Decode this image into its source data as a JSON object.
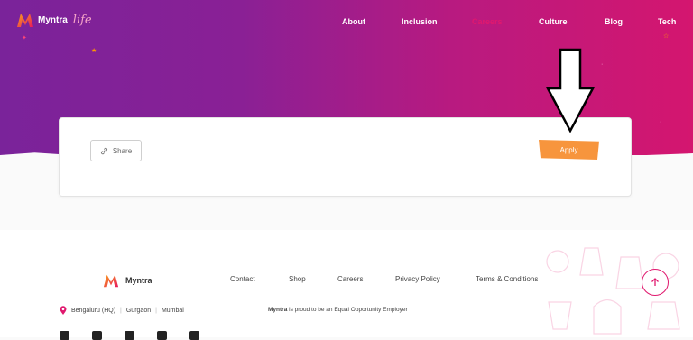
{
  "header": {
    "brand": "Myntra",
    "brand_suffix": "life",
    "nav": [
      "About",
      "Inclusion",
      "Careers",
      "Culture",
      "Blog",
      "Tech"
    ],
    "active_nav": "Careers"
  },
  "card": {
    "share_label": "Share",
    "apply_label": "Apply"
  },
  "footer": {
    "brand": "Myntra",
    "links": [
      "Contact",
      "Shop",
      "Careers",
      "Privacy Policy",
      "Terms & Conditions"
    ],
    "locations": [
      "Bengaluru (HQ)",
      "Gurgaon",
      "Mumbai"
    ],
    "eoe_brand": "Myntra",
    "eoe_text": " is proud to be an Equal Opportunity Employer",
    "socials": [
      "linkedin-icon",
      "facebook-icon",
      "youtube-icon",
      "instagram-icon",
      "twitter-icon"
    ]
  },
  "colors": {
    "accent_pink": "#e0186e",
    "apply_orange": "#f7953d",
    "hero_start": "#7a239a",
    "hero_end": "#d4166f"
  }
}
